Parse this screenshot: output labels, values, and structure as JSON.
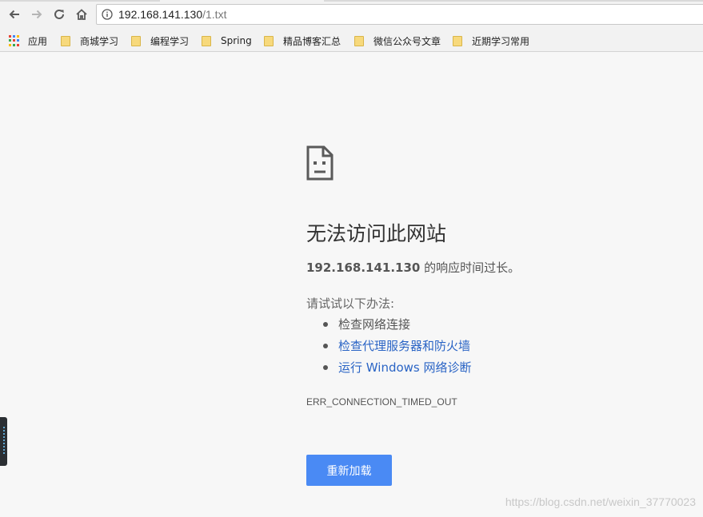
{
  "browser": {
    "url_host": "192.168.141.130",
    "url_path": "/1.txt"
  },
  "bookmarks": {
    "apps_label": "应用",
    "items": [
      {
        "label": "商城学习"
      },
      {
        "label": "编程学习"
      },
      {
        "label": "Spring"
      },
      {
        "label": "精品博客汇总"
      },
      {
        "label": "微信公众号文章"
      },
      {
        "label": "近期学习常用"
      }
    ]
  },
  "error_page": {
    "title": "无法访问此网站",
    "host": "192.168.141.130",
    "description_suffix": " 的响应时间过长。",
    "suggestions_heading": "请试试以下办法:",
    "suggestions": [
      "检查网络连接",
      "检查代理服务器和防火墙",
      "运行 Windows 网络诊断"
    ],
    "error_code": "ERR_CONNECTION_TIMED_OUT",
    "reload_label": "重新加载"
  },
  "watermark": "https://blog.csdn.net/weixin_37770023",
  "colors": {
    "link": "#2a64c5",
    "button": "#4a8af4",
    "page_background": "#f7f7f7"
  },
  "icons": [
    "back-icon",
    "forward-icon",
    "reload-icon",
    "home-icon",
    "info-icon",
    "apps-icon",
    "folder-icon",
    "sad-page-icon"
  ]
}
